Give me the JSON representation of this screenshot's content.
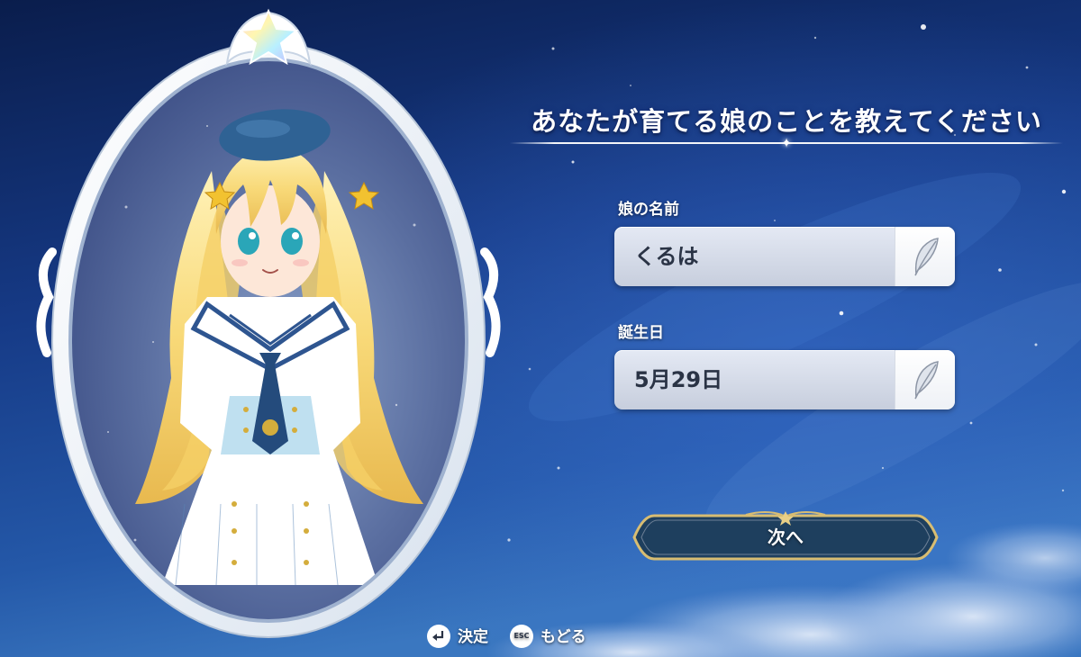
{
  "prompt": {
    "title": "あなたが育てる娘のことを教えてください"
  },
  "form": {
    "name_label": "娘の名前",
    "name_value": "くるは",
    "birthday_label": "誕生日",
    "birthday_value": "5月29日"
  },
  "actions": {
    "next_label": "次へ"
  },
  "controls": {
    "confirm_label": "決定",
    "back_key": "ESC",
    "back_label": "もどる"
  },
  "icons": {
    "edit": "feather-quill-icon",
    "confirm": "enter-key-icon",
    "back": "esc-key-icon",
    "frame_ornament": "rainbow-star-icon"
  },
  "colors": {
    "night_sky": "#0d2458",
    "gold_trim": "#d8bd72",
    "button_fill": "#1e3f5e",
    "field_fill": "#d2d8e6"
  }
}
